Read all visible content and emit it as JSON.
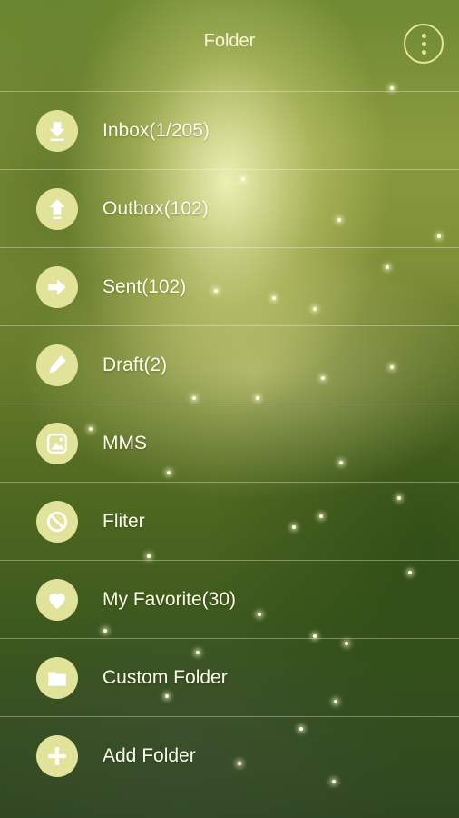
{
  "header": {
    "title": "Folder",
    "menu_icon": "more-vertical-icon"
  },
  "folders": [
    {
      "label": "Inbox(1/205)",
      "icon": "inbox-download-icon"
    },
    {
      "label": "Outbox(102)",
      "icon": "outbox-upload-icon"
    },
    {
      "label": "Sent(102)",
      "icon": "sent-arrow-icon"
    },
    {
      "label": "Draft(2)",
      "icon": "draft-pencil-icon"
    },
    {
      "label": "MMS",
      "icon": "mms-picture-icon"
    },
    {
      "label": "Fliter",
      "icon": "filter-block-icon"
    },
    {
      "label": "My Favorite(30)",
      "icon": "favorite-heart-icon"
    },
    {
      "label": "Custom Folder",
      "icon": "custom-folder-icon"
    },
    {
      "label": "Add Folder",
      "icon": "add-plus-icon"
    }
  ],
  "colors": {
    "icon_circle": "#e2e39a",
    "icon_glyph": "#ffffff",
    "text": "#fbfbe8",
    "divider": "rgba(255,255,220,0.35)"
  }
}
